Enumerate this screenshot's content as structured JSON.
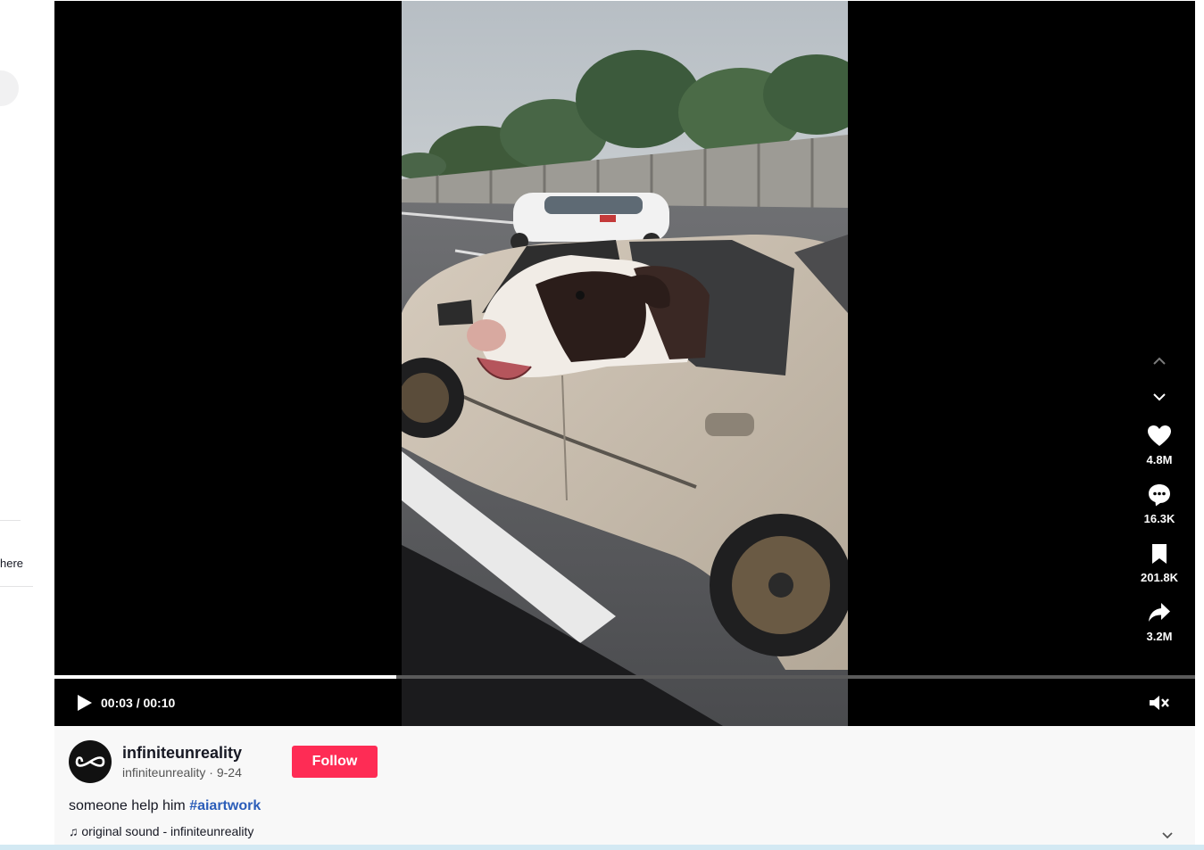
{
  "sidebar": {
    "partial_text": "here"
  },
  "video": {
    "time_display": "00:03 / 00:10",
    "progress": 0.3,
    "muted": true
  },
  "actions": {
    "likes": "4.8M",
    "comments": "16.3K",
    "saves": "201.8K",
    "shares": "3.2M"
  },
  "post": {
    "username": "infiniteunreality",
    "handle": "infiniteunreality",
    "separator": " · ",
    "date": "9-24",
    "follow_label": "Follow",
    "caption": "someone help him ",
    "hashtag": "#aiartwork",
    "sound": "original sound - infiniteunreality",
    "sound_icon": "♫"
  },
  "colors": {
    "accent": "#fe2c55",
    "hashtag": "#2b5db9",
    "stage": "#000000",
    "panel": "#f8f8f8"
  },
  "icons": [
    "play-icon",
    "mute-icon",
    "chevron-up-icon",
    "chevron-down-icon",
    "heart-icon",
    "comment-icon",
    "bookmark-icon",
    "share-icon",
    "infinity-icon",
    "music-note-icon",
    "expand-chevron-icon"
  ]
}
